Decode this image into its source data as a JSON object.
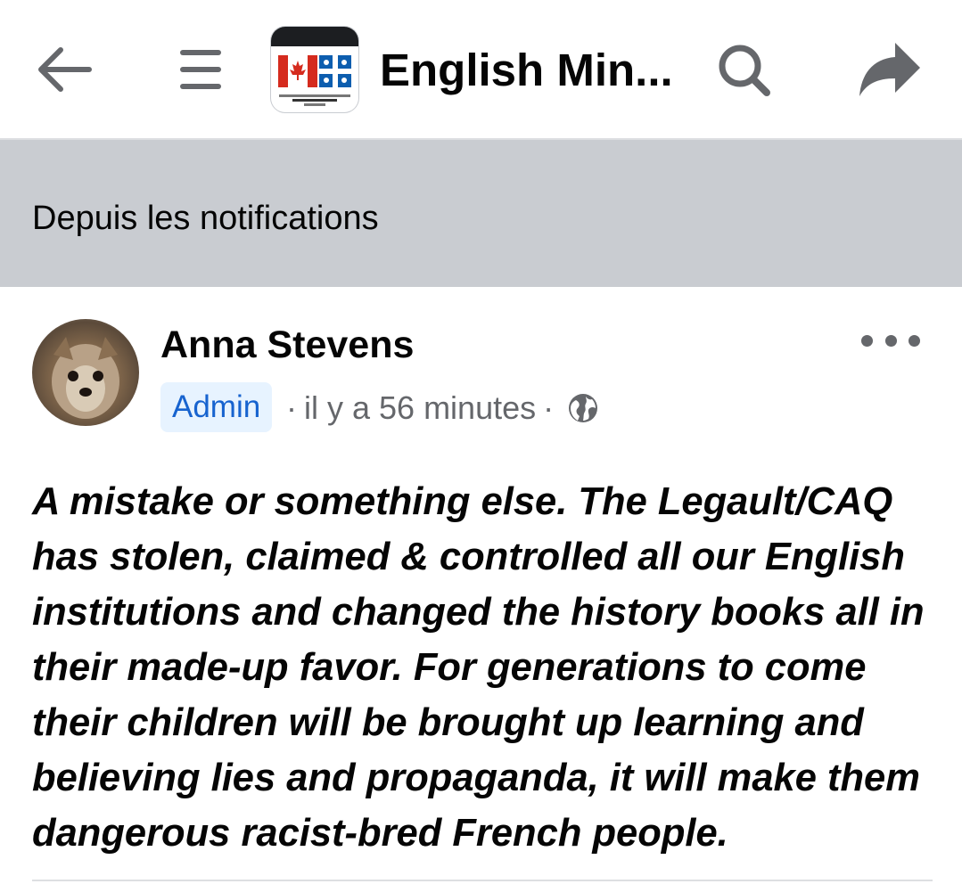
{
  "header": {
    "title": "English Min...",
    "icons": {
      "back": "arrow-left-icon",
      "menu": "menu-icon",
      "search": "search-icon",
      "share": "share-icon"
    }
  },
  "banner": {
    "text": "Depuis les notifications"
  },
  "post": {
    "author": "Anna Stevens",
    "role_badge": "Admin",
    "timestamp": "il y a 56 minutes",
    "audience_icon": "globe-icon",
    "more_icon": "more-icon",
    "body": "A mistake or something else. The Legault/CAQ has stolen, claimed & controlled all our English institutions and changed the history books all in their made-up favor. For generations to come their children will be brought up learning and believing lies and propaganda, it will make them dangerous racist-bred French people."
  },
  "colors": {
    "banner_bg": "#c9ccd1",
    "badge_bg": "#e7f3ff",
    "badge_text": "#1763cf",
    "meta_text": "#65676b",
    "icon": "#65676b"
  }
}
